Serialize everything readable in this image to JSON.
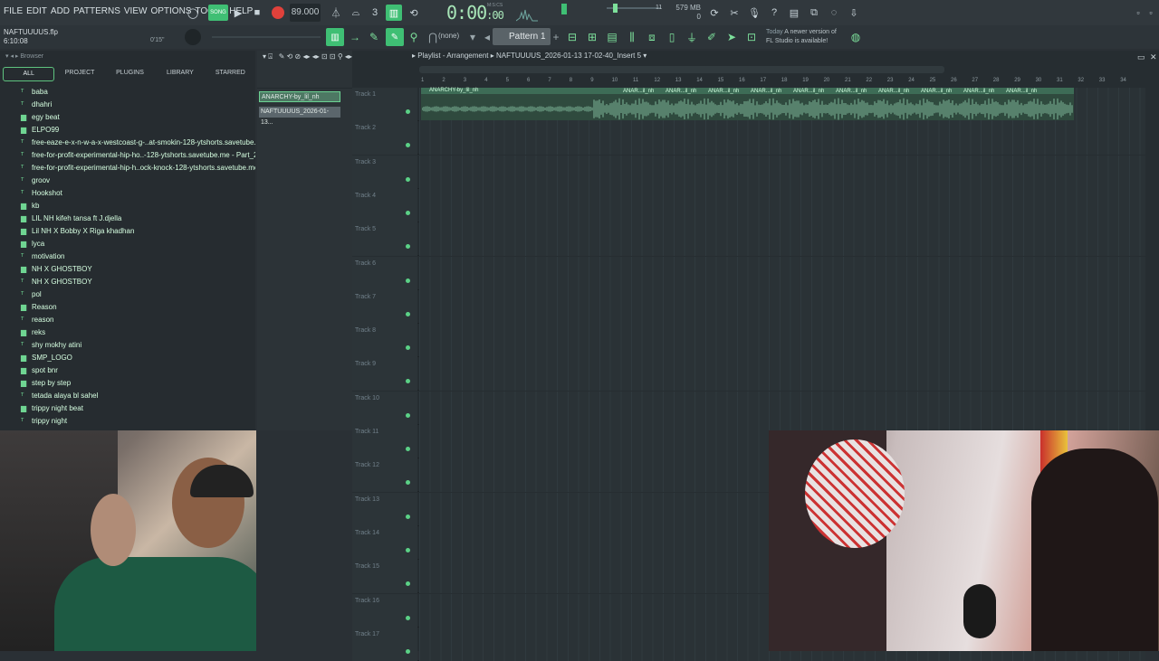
{
  "menu": [
    "FILE",
    "EDIT",
    "ADD",
    "PATTERNS",
    "VIEW",
    "OPTIONS",
    "TOOLS",
    "HELP"
  ],
  "transport": {
    "song_label": "SONG",
    "tempo": "89.000",
    "time": "0:00",
    "time_small": ":00",
    "time_format": "M:S:CS",
    "memory": "579 MB",
    "cpu": "11",
    "poly": "0"
  },
  "project": {
    "file": "NAFTUUUUS.flp",
    "length": "6:10:08",
    "position": "0'15\""
  },
  "toolbar": {
    "snap": "(none)",
    "pattern": "Pattern 1",
    "notice_today": "Today",
    "notice_text_1": "A newer version of",
    "notice_text_2": "FL Studio is available!"
  },
  "browser": {
    "title": "Browser",
    "tabs": [
      "ALL",
      "PROJECT",
      "PLUGINS",
      "LIBRARY",
      "STARRED"
    ],
    "items": [
      {
        "label": "baba",
        "icon": "audio-icon"
      },
      {
        "label": "dhahri",
        "icon": "audio-icon"
      },
      {
        "label": "egy beat",
        "icon": "folder-icon"
      },
      {
        "label": "ELPO99",
        "icon": "folder-icon"
      },
      {
        "label": "free-eaze-e-x-n-w-a-x-westcoast-g-..at-smokin-128-ytshorts.savetube.me",
        "icon": "audio-icon"
      },
      {
        "label": "free-for-profit-experimental-hip-ho..-128-ytshorts.savetube.me - Part_2",
        "icon": "audio-icon"
      },
      {
        "label": "free-for-profit-experimental-hip-h..ock-knock-128-ytshorts.savetube.me",
        "icon": "audio-icon"
      },
      {
        "label": "groov",
        "icon": "audio-icon"
      },
      {
        "label": "Hookshot",
        "icon": "audio-icon"
      },
      {
        "label": "kb",
        "icon": "folder-icon"
      },
      {
        "label": "LIL NH kifeh tansa ft J.djella",
        "icon": "folder-icon"
      },
      {
        "label": "Lil NH X Bobby X Riga khadhan",
        "icon": "folder-icon"
      },
      {
        "label": "lyca",
        "icon": "folder-icon"
      },
      {
        "label": "motivation",
        "icon": "audio-icon"
      },
      {
        "label": "NH X GHOSTBOY",
        "icon": "folder-icon"
      },
      {
        "label": "NH X GHOSTBOY",
        "icon": "audio-icon"
      },
      {
        "label": "pol",
        "icon": "audio-icon"
      },
      {
        "label": "Reason",
        "icon": "folder-icon"
      },
      {
        "label": "reason",
        "icon": "audio-icon"
      },
      {
        "label": "reks",
        "icon": "folder-icon"
      },
      {
        "label": "shy mokhy atini",
        "icon": "audio-icon"
      },
      {
        "label": "SMP_LOGO",
        "icon": "folder-icon"
      },
      {
        "label": "spot bnr",
        "icon": "folder-icon"
      },
      {
        "label": "step by step",
        "icon": "folder-icon"
      },
      {
        "label": "tetada alaya bl sahel",
        "icon": "audio-icon"
      },
      {
        "label": "trippy night beat",
        "icon": "folder-icon"
      },
      {
        "label": "trippy night",
        "icon": "audio-icon"
      }
    ]
  },
  "picker": {
    "clips": [
      "ANARCHY-by_lil_nh",
      "NAFTUUUUS_2026-01-13..."
    ]
  },
  "playlist": {
    "title_prefix": "Playlist - Arrangement",
    "title_project": "NAFTUUUUS_2026-01-13 17-02-40_Insert 5",
    "ruler": [
      "1",
      "2",
      "3",
      "4",
      "5",
      "6",
      "7",
      "8",
      "9",
      "10",
      "11",
      "12",
      "13",
      "14",
      "15",
      "16",
      "17",
      "18",
      "19",
      "20",
      "21",
      "22",
      "23",
      "24",
      "25",
      "26",
      "27",
      "28",
      "29",
      "30",
      "31",
      "32",
      "33",
      "34"
    ],
    "clip_label": "ANARCHY-by_lil_nh",
    "clip_repeat": "ANAR...il_nh",
    "tracks": [
      "Track 1",
      "Track 2",
      "Track 3",
      "Track 4",
      "Track 5",
      "Track 6",
      "Track 7",
      "Track 8",
      "Track 9",
      "Track 10",
      "Track 11",
      "Track 12",
      "Track 13",
      "Track 14",
      "Track 15",
      "Track 16",
      "Track 17"
    ]
  },
  "colors": {
    "accent": "#3fbf74",
    "record": "#e0413b",
    "clip": "#3d6c56"
  }
}
